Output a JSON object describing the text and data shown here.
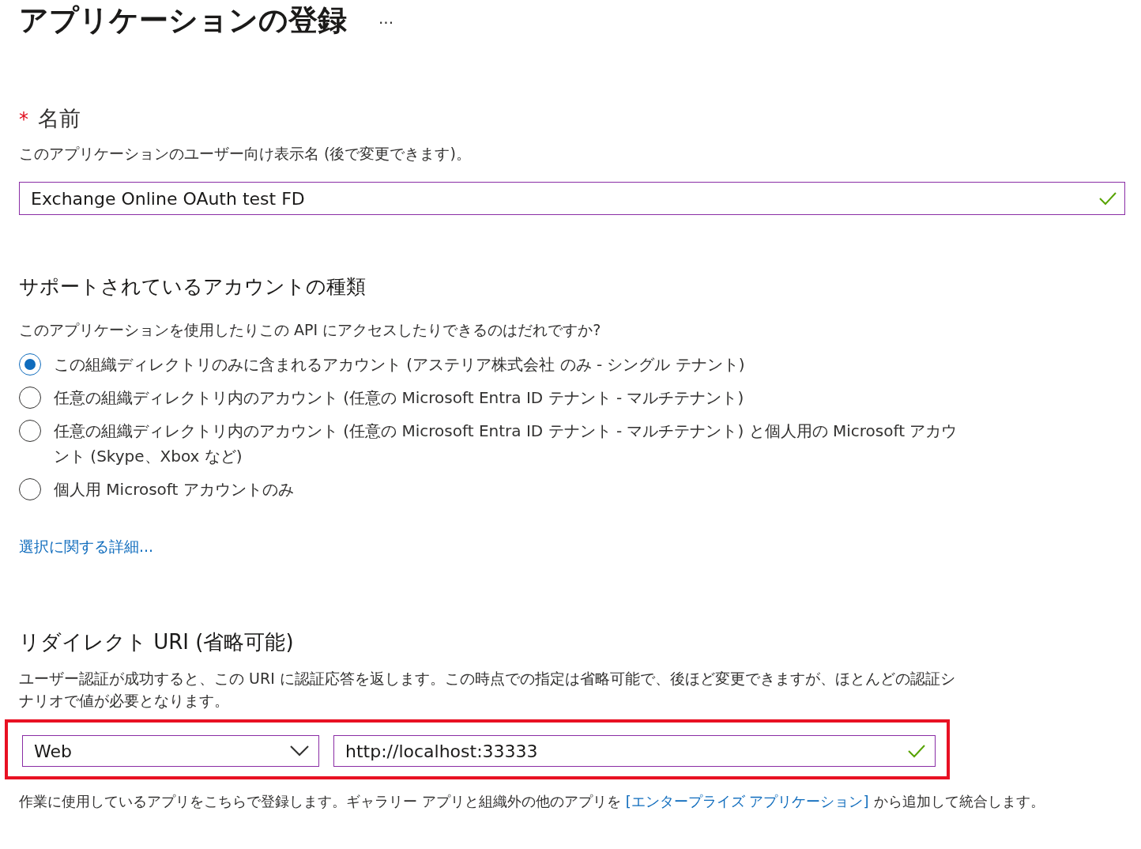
{
  "title": "アプリケーションの登録",
  "more": "···",
  "name_section": {
    "required_mark": "*",
    "label": "名前",
    "description": "このアプリケーションのユーザー向け表示名 (後で変更できます)。",
    "field": {
      "value": "Exchange Online OAuth test FD",
      "valid": true
    }
  },
  "account_types": {
    "heading": "サポートされているアカウントの種類",
    "question": "このアプリケーションを使用したりこの API にアクセスしたりできるのはだれですか?",
    "options": [
      {
        "label": "この組織ディレクトリのみに含まれるアカウント (アステリア株式会社 のみ - シングル テナント)",
        "selected": true
      },
      {
        "label": "任意の組織ディレクトリ内のアカウント (任意の Microsoft Entra ID テナント - マルチテナント)",
        "selected": false
      },
      {
        "label": "任意の組織ディレクトリ内のアカウント (任意の Microsoft Entra ID テナント - マルチテナント) と個人用の Microsoft アカウント (Skype、Xbox など)",
        "selected": false
      },
      {
        "label": "個人用 Microsoft アカウントのみ",
        "selected": false
      }
    ],
    "link": "選択に関する詳細..."
  },
  "redirect": {
    "heading": "リダイレクト URI (省略可能)",
    "description": "ユーザー認証が成功すると、この URI に認証応答を返します。この時点での指定は省略可能で、後ほど変更できますが、ほとんどの認証シナリオで値が必要となります。",
    "highlighted": true,
    "platform": {
      "value": "Web"
    },
    "uri": {
      "value": "http://localhost:33333",
      "valid": true
    }
  },
  "footer": {
    "text": "作業に使用しているアプリをこちらで登録します。ギャラリー アプリと組織外の他のアプリを",
    "link": "[エンタープライズ アプリケーション]",
    "text_after": "から追加して統合します。"
  }
}
